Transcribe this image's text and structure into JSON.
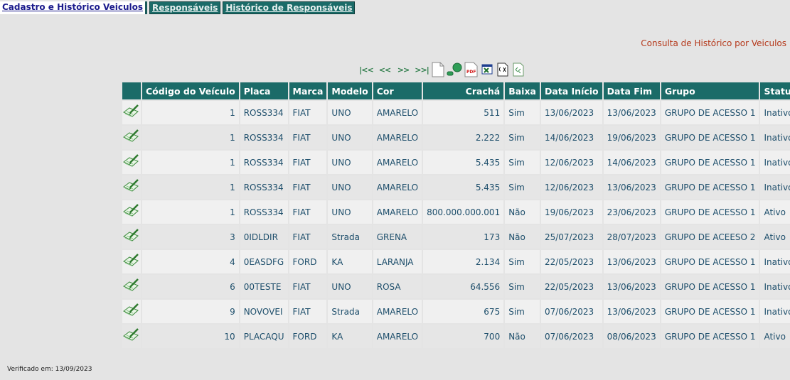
{
  "tabs": [
    {
      "label": "Cadastro e Histórico Veiculos"
    },
    {
      "label": "Responsáveis"
    },
    {
      "label": "Histórico de Responsáveis"
    }
  ],
  "page": {
    "subtitle": "Consulta de Histórico por Veiculos"
  },
  "toolbar": {
    "first": "|<<",
    "prev": "<<",
    "next": ">>",
    "last": ">>|"
  },
  "table": {
    "columns": [
      "",
      "Código do Veículo",
      "Placa",
      "Marca",
      "Modelo",
      "Cor",
      "Crachá",
      "Baixa",
      "Data Início",
      "Data Fim",
      "Grupo",
      "Status"
    ],
    "rows": [
      [
        "1",
        "ROSS334",
        "FIAT",
        "UNO",
        "AMARELO",
        "511",
        "Sim",
        "13/06/2023",
        "13/06/2023",
        "GRUPO DE ACESSO 1",
        "Inativo"
      ],
      [
        "1",
        "ROSS334",
        "FIAT",
        "UNO",
        "AMARELO",
        "2.222",
        "Sim",
        "14/06/2023",
        "19/06/2023",
        "GRUPO DE ACESSO 1",
        "Inativo"
      ],
      [
        "1",
        "ROSS334",
        "FIAT",
        "UNO",
        "AMARELO",
        "5.435",
        "Sim",
        "12/06/2023",
        "14/06/2023",
        "GRUPO DE ACESSO 1",
        "Inativo"
      ],
      [
        "1",
        "ROSS334",
        "FIAT",
        "UNO",
        "AMARELO",
        "5.435",
        "Sim",
        "12/06/2023",
        "13/06/2023",
        "GRUPO DE ACESSO 1",
        "Inativo"
      ],
      [
        "1",
        "ROSS334",
        "FIAT",
        "UNO",
        "AMARELO",
        "800.000.000.001",
        "Não",
        "19/06/2023",
        "23/06/2023",
        "GRUPO DE ACESSO 1",
        "Ativo"
      ],
      [
        "3",
        "0IDLDIR",
        "FIAT",
        "Strada",
        "GRENA",
        "173",
        "Não",
        "25/07/2023",
        "28/07/2023",
        "GRUPO DE ACEESO 2",
        "Ativo"
      ],
      [
        "4",
        "0EASDFG",
        "FORD",
        "KA",
        "LARANJA",
        "2.134",
        "Sim",
        "22/05/2023",
        "13/06/2023",
        "GRUPO DE ACESSO 1",
        "Inativo"
      ],
      [
        "6",
        "00TESTE",
        "FIAT",
        "UNO",
        "ROSA",
        "64.556",
        "Sim",
        "22/05/2023",
        "13/06/2023",
        "GRUPO DE ACESSO 1",
        "Inativo"
      ],
      [
        "9",
        "NOVOVEI",
        "FIAT",
        "Strada",
        "AMARELO",
        "675",
        "Sim",
        "07/06/2023",
        "13/06/2023",
        "GRUPO DE ACESSO 1",
        "Inativo"
      ],
      [
        "10",
        "PLACAQU",
        "FORD",
        "KA",
        "AMARELO",
        "700",
        "Não",
        "07/06/2023",
        "08/06/2023",
        "GRUPO DE ACESSO 1",
        "Ativo"
      ]
    ]
  },
  "footer": {
    "verified": "Verificado em: 13/09/2023"
  },
  "colors": {
    "header": "#1b6b68",
    "accent": "#b5381a",
    "text": "#1d4e6b"
  }
}
